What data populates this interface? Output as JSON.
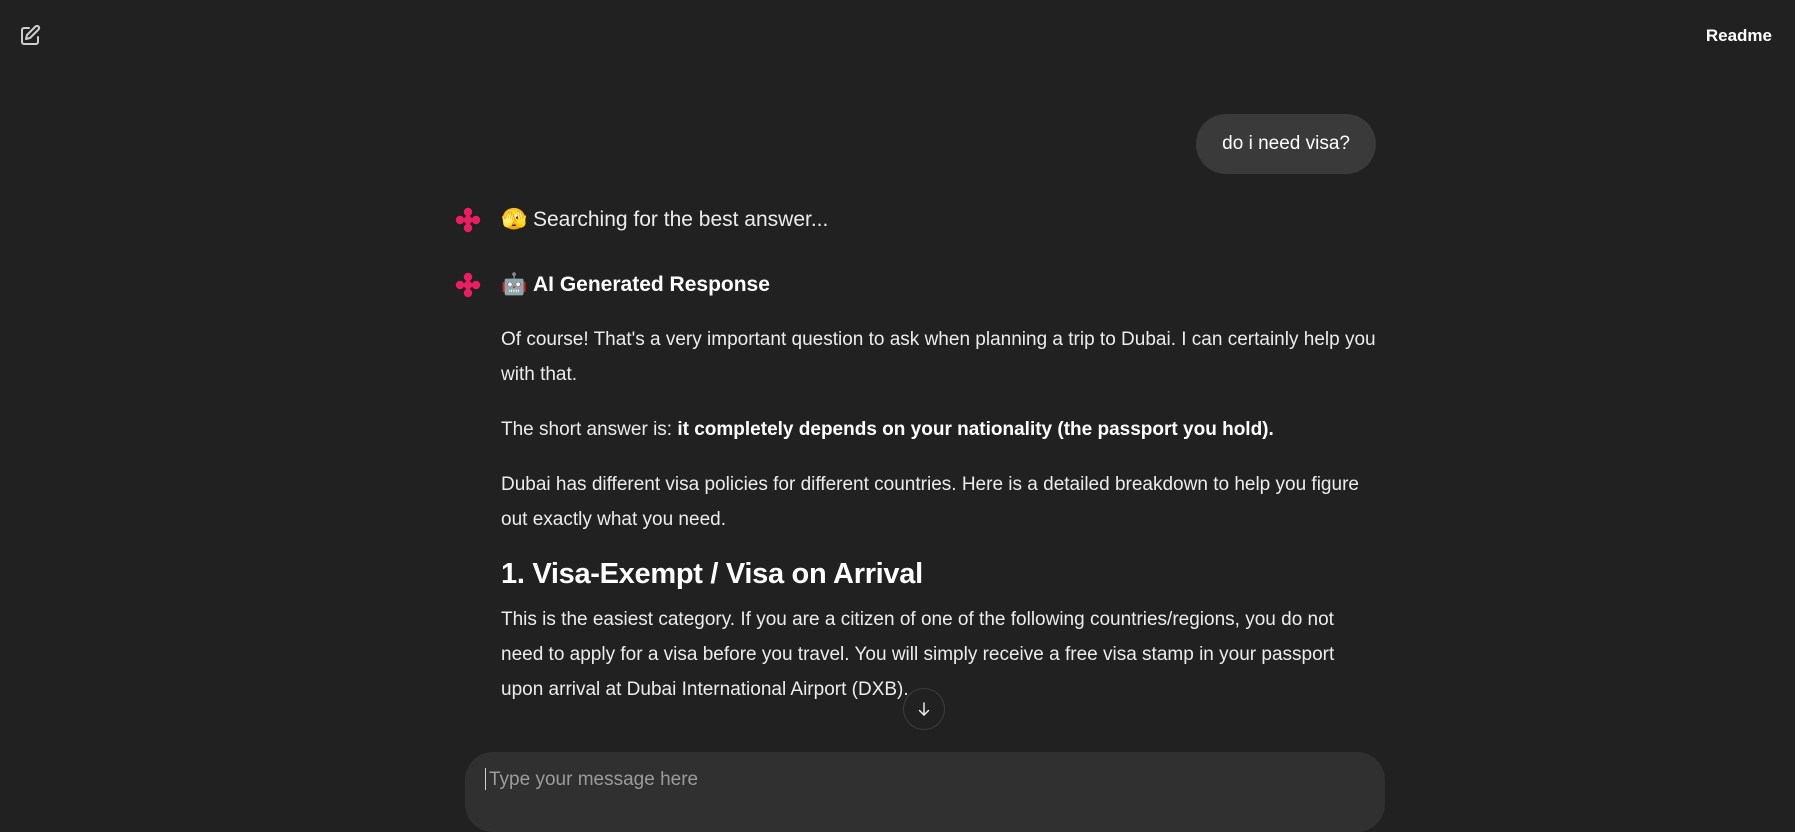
{
  "header": {
    "new_chat_icon": "edit-square-icon",
    "readme_label": "Readme"
  },
  "conversation": {
    "user_message": "do i need visa?",
    "status": {
      "emoji": "🫣",
      "text": "Searching for the best answer..."
    },
    "response": {
      "emoji": "🤖",
      "title": "AI Generated Response",
      "paragraph1": "Of course! That's a very important question to ask when planning a trip to Dubai. I can certainly help you with that.",
      "paragraph2_prefix": "The short answer is: ",
      "paragraph2_bold": "it completely depends on your nationality (the passport you hold).",
      "paragraph3": "Dubai has different visa policies for different countries. Here is a detailed breakdown to help you figure out exactly what you need.",
      "heading1": "1. Visa-Exempt / Visa on Arrival",
      "paragraph4": "This is the easiest category. If you are a citizen of one of the following countries/regions, you do not need to apply for a visa before you travel. You will simply receive a free visa stamp in your passport upon arrival at Dubai International Airport (DXB)."
    }
  },
  "composer": {
    "placeholder": "Type your message here",
    "value": ""
  },
  "colors": {
    "background": "#212121",
    "bubble": "#3a3a3a",
    "composer": "#303030",
    "brand_logo": "#e91e63"
  },
  "icons": {
    "bot_logo": "pink-sparkle-logo-icon",
    "scroll_down": "arrow-down-icon"
  }
}
